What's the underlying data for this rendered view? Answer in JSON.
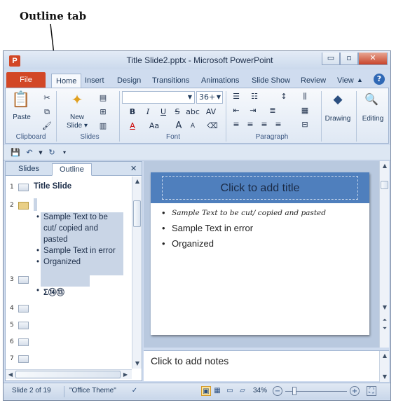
{
  "annotation": {
    "label": "Outline tab"
  },
  "window": {
    "title": "Title Slide2.pptx - Microsoft PowerPoint",
    "app_icon": "P",
    "min": "▭",
    "max": "▫",
    "close": "✕"
  },
  "quick_access_top": {
    "save_icon": "save-icon",
    "undo_icon": "undo-icon",
    "redo_icon": "redo-icon"
  },
  "tabs": [
    "File",
    "Home",
    "Insert",
    "Design",
    "Transitions",
    "Animations",
    "Slide Show",
    "Review",
    "View"
  ],
  "help": "?",
  "ribbon": {
    "clipboard": {
      "label": "Clipboard",
      "paste": "Paste"
    },
    "slides": {
      "label": "Slides",
      "new_slide_1": "New",
      "new_slide_2": "Slide ▾"
    },
    "font": {
      "label": "Font",
      "size": "36+",
      "font_name": "",
      "bold": "B",
      "italic": "I",
      "underline": "U",
      "strike": "S",
      "shadow": "abc",
      "spacing": "AV",
      "color": "A",
      "case": "Aa",
      "grow": "A",
      "shrink": "A"
    },
    "paragraph": {
      "label": "Paragraph"
    },
    "drawing": {
      "label": "Drawing"
    },
    "editing": {
      "label": "Editing"
    }
  },
  "left_panel": {
    "tab_slides": "Slides",
    "tab_outline": "Outline",
    "close": "✕",
    "items": [
      {
        "num": "1",
        "title": "Title Slide"
      },
      {
        "num": "2",
        "bullets": [
          "Sample Text to be",
          "cut/ copied and",
          "pasted",
          "Sample Text in error",
          "Organized"
        ]
      },
      {
        "num": "3",
        "symbols": "Σ⑭⑬"
      },
      {
        "num": "4"
      },
      {
        "num": "5"
      },
      {
        "num": "6"
      },
      {
        "num": "7"
      }
    ]
  },
  "slide": {
    "title_placeholder": "Click to add title",
    "bullets": [
      "Sample Text to be cut/ copied and pasted",
      "Sample Text in error",
      "Organized"
    ]
  },
  "notes": {
    "placeholder": "Click to add notes"
  },
  "status": {
    "slide": "Slide 2 of 19",
    "theme": "\"Office Theme\"",
    "zoom": "34%",
    "zoom_out": "−",
    "zoom_in": "+"
  }
}
